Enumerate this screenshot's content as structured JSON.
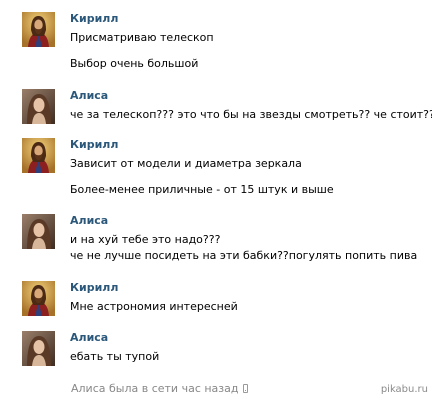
{
  "messages": [
    {
      "author": "Кирилл",
      "avatar": "jesus-portrait",
      "lines": [
        "Присматриваю телескоп",
        "Выбор очень большой"
      ]
    },
    {
      "author": "Алиса",
      "avatar": "girl-photo",
      "lines": [
        "че за телескоп??? это что бы на звезды смотреть?? че стоит??"
      ]
    },
    {
      "author": "Кирилл",
      "avatar": "jesus-portrait",
      "lines": [
        "Зависит от модели и диаметра зеркала",
        "Более-менее приличные - от 15 штук и выше"
      ]
    },
    {
      "author": "Алиса",
      "avatar": "girl-photo",
      "lines": [
        "и на хуй тебе это надо???",
        "че не лучше посидеть на эти бабки??погулять попить пива"
      ]
    },
    {
      "author": "Кирилл",
      "avatar": "jesus-portrait",
      "lines": [
        "Мне астрономия интересней"
      ]
    },
    {
      "author": "Алиса",
      "avatar": "girl-photo",
      "lines": [
        "ебать ты тупой"
      ]
    }
  ],
  "status": {
    "text": "Алиса была в сети час назад",
    "icon": "mobile-phone-icon"
  },
  "watermark": "pikabu.ru",
  "colors": {
    "author_name": "#2b587a",
    "message_text": "#000000",
    "status_text": "#888888"
  }
}
